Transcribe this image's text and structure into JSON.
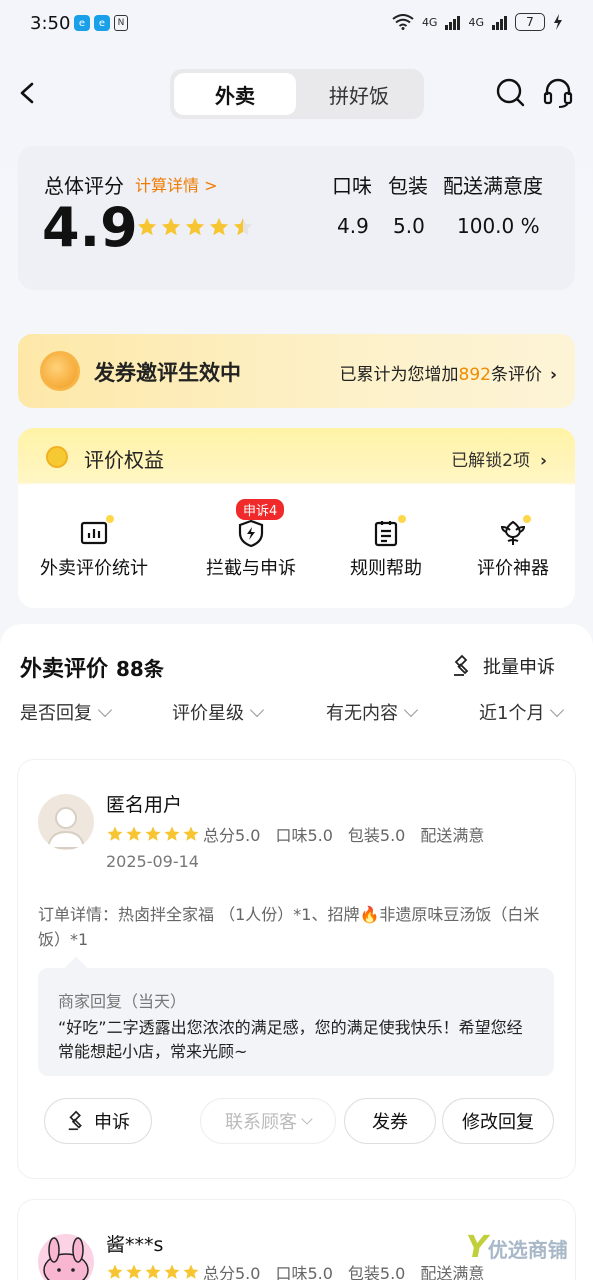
{
  "status_bar": {
    "time": "3:50",
    "net1": "4G",
    "net2": "4G",
    "battery": "7"
  },
  "header": {
    "tabs": [
      "外卖",
      "拼好饭"
    ],
    "active_tab": 0
  },
  "score": {
    "label": "总体评分",
    "calc_link": "计算详情 >",
    "overall": "4.9",
    "overall_stars": 4.5,
    "metrics": [
      {
        "label": "口味",
        "value": "4.9"
      },
      {
        "label": "包装",
        "value": "5.0"
      },
      {
        "label": "配送满意度",
        "value": "100.0 %"
      }
    ]
  },
  "coupon_banner": {
    "title": "发券邀评生效中",
    "desc_prefix": "已累计为您增加",
    "count": "892",
    "desc_suffix": "条评价"
  },
  "rights": {
    "title": "评价权益",
    "unlock": "已解锁2项",
    "badge": "申诉4",
    "tools": [
      {
        "label": "外卖评价统计",
        "icon": "chart-icon"
      },
      {
        "label": "拦截与申诉",
        "icon": "shield-bolt-icon"
      },
      {
        "label": "规则帮助",
        "icon": "clipboard-icon"
      },
      {
        "label": "评价神器",
        "icon": "flower-icon"
      }
    ]
  },
  "reviews": {
    "title": "外卖评价",
    "count": "88条",
    "batch_appeal": "批量申诉",
    "filters": [
      "是否回复",
      "评价星级",
      "有无内容",
      "近1个月"
    ],
    "items": [
      {
        "user": "匿名用户",
        "stars": 5,
        "total": "总分5.0",
        "taste": "口味5.0",
        "package": "包装5.0",
        "delivery": "配送满意",
        "date": "2025-09-14",
        "order": "订单详情：热卤拌全家福 （1人份）*1、招牌🔥非遗原味豆汤饭（白米饭）*1",
        "reply_title": "商家回复（当天）",
        "reply_content": "“好吃”二字透露出您浓浓的满足感，您的满足使我快乐！希望您经常能想起小店，常来光顾~",
        "actions": [
          "申诉",
          "联系顾客",
          "发券",
          "修改回复"
        ]
      },
      {
        "user": "酱***s",
        "stars": 5,
        "total": "总分5.0",
        "taste": "口味5.0",
        "package": "包装5.0",
        "delivery": "配送满意"
      }
    ]
  },
  "watermark": {
    "logo": "Y",
    "text": "优选商铺"
  },
  "colors": {
    "accent": "#f07b00",
    "star": "#f7c531",
    "badge": "#f02a2a"
  }
}
